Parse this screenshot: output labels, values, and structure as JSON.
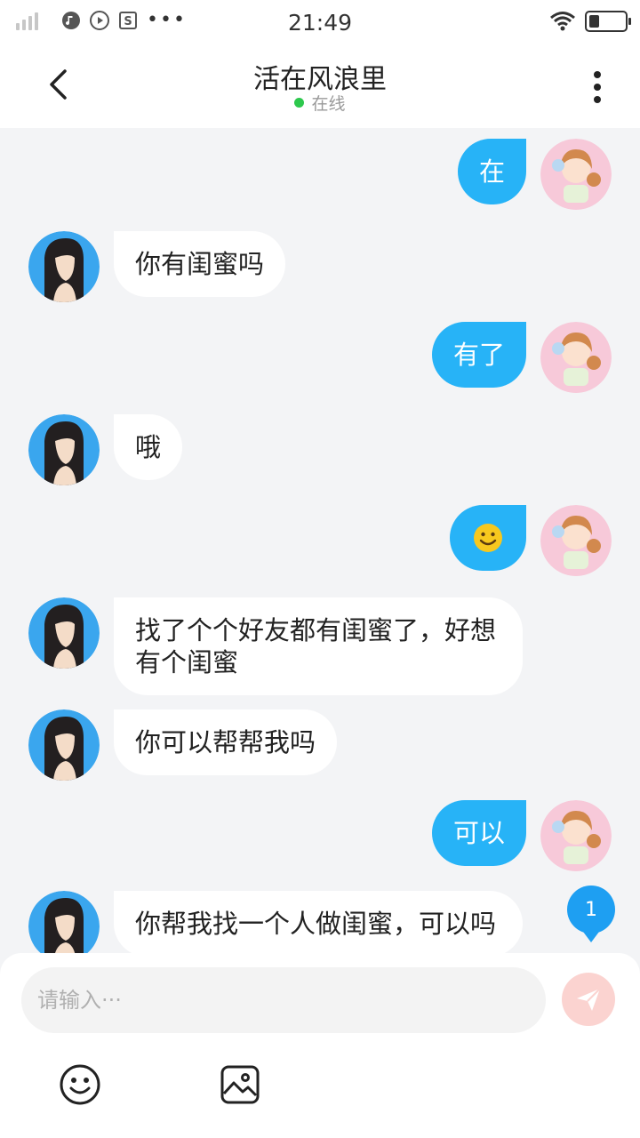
{
  "status_bar": {
    "time": "21:49",
    "battery_level": 0.3
  },
  "header": {
    "title": "活在风浪里",
    "presence": "在线"
  },
  "messages": [
    {
      "side": "out",
      "text": "在"
    },
    {
      "side": "in",
      "text": "你有闺蜜吗"
    },
    {
      "side": "out",
      "text": "有了"
    },
    {
      "side": "in",
      "text": "哦"
    },
    {
      "side": "out",
      "text": "🙂",
      "kind": "emoji"
    },
    {
      "side": "in",
      "text": "找了个个好友都有闺蜜了，好想有个闺蜜"
    },
    {
      "side": "in",
      "text": "你可以帮帮我吗"
    },
    {
      "side": "out",
      "text": "可以"
    },
    {
      "side": "in",
      "text": "你帮我找一个人做闺蜜，可以吗"
    }
  ],
  "unread_count": "1",
  "composer": {
    "placeholder": "请输入···"
  },
  "colors": {
    "outgoing_bubble": "#27b3f7",
    "online_dot": "#2dc84d",
    "send_button": "#fbd3d0",
    "unread_badge": "#1e9ff2"
  }
}
